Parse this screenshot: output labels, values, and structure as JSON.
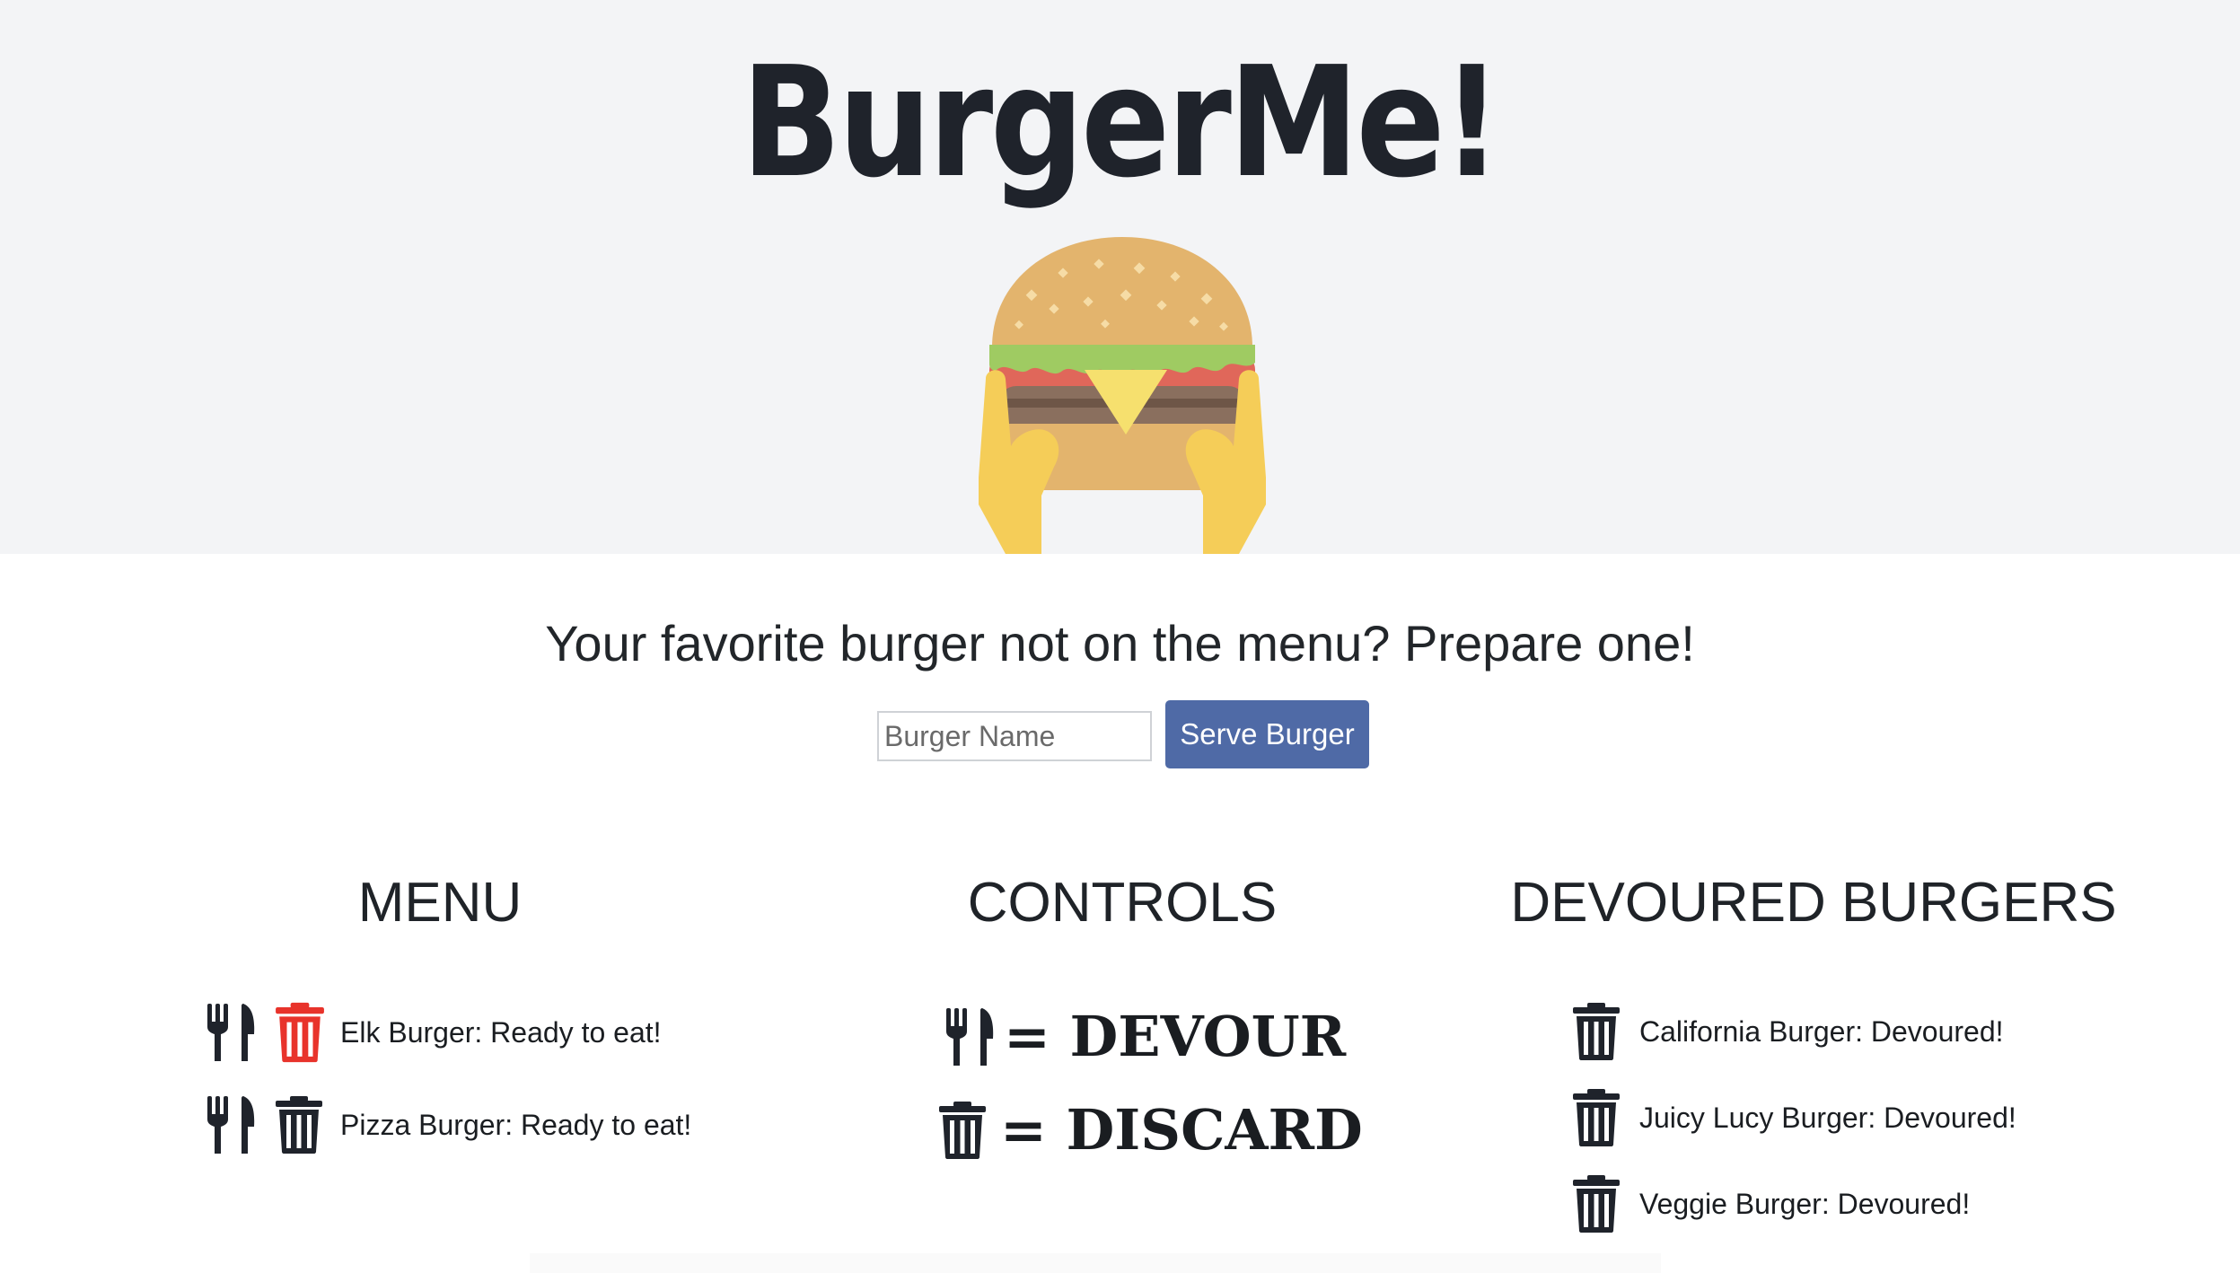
{
  "header": {
    "title": "BurgerMe!",
    "hero_image": "burger-in-hands-icon"
  },
  "form": {
    "prompt": "Your favorite burger not on the menu? Prepare one!",
    "input_placeholder": "Burger Name",
    "input_value": "",
    "submit_label": "Serve Burger",
    "submit_color": "#4f6aa6"
  },
  "menu": {
    "heading": "MENU",
    "items": [
      {
        "text": "Elk Burger: Ready to eat!",
        "eat_icon": "fork-knife-icon",
        "discard_icon": "trash-icon",
        "discard_color": "#e8332b"
      },
      {
        "text": "Pizza Burger: Ready to eat!",
        "eat_icon": "fork-knife-icon",
        "discard_icon": "trash-icon",
        "discard_color": "#1f232b"
      }
    ]
  },
  "controls": {
    "heading": "CONTROLS",
    "devour_label": "= DEVOUR",
    "discard_label": "= DISCARD"
  },
  "devoured": {
    "heading": "DEVOURED BURGERS",
    "items": [
      {
        "text": "California Burger: Devoured!",
        "icon": "trash-icon"
      },
      {
        "text": "Juicy Lucy Burger: Devoured!",
        "icon": "trash-icon"
      },
      {
        "text": "Veggie Burger: Devoured!",
        "icon": "trash-icon"
      }
    ]
  },
  "colors": {
    "jumbotron_bg": "#f3f4f6",
    "text_dark": "#1f232b",
    "danger": "#e8332b"
  }
}
